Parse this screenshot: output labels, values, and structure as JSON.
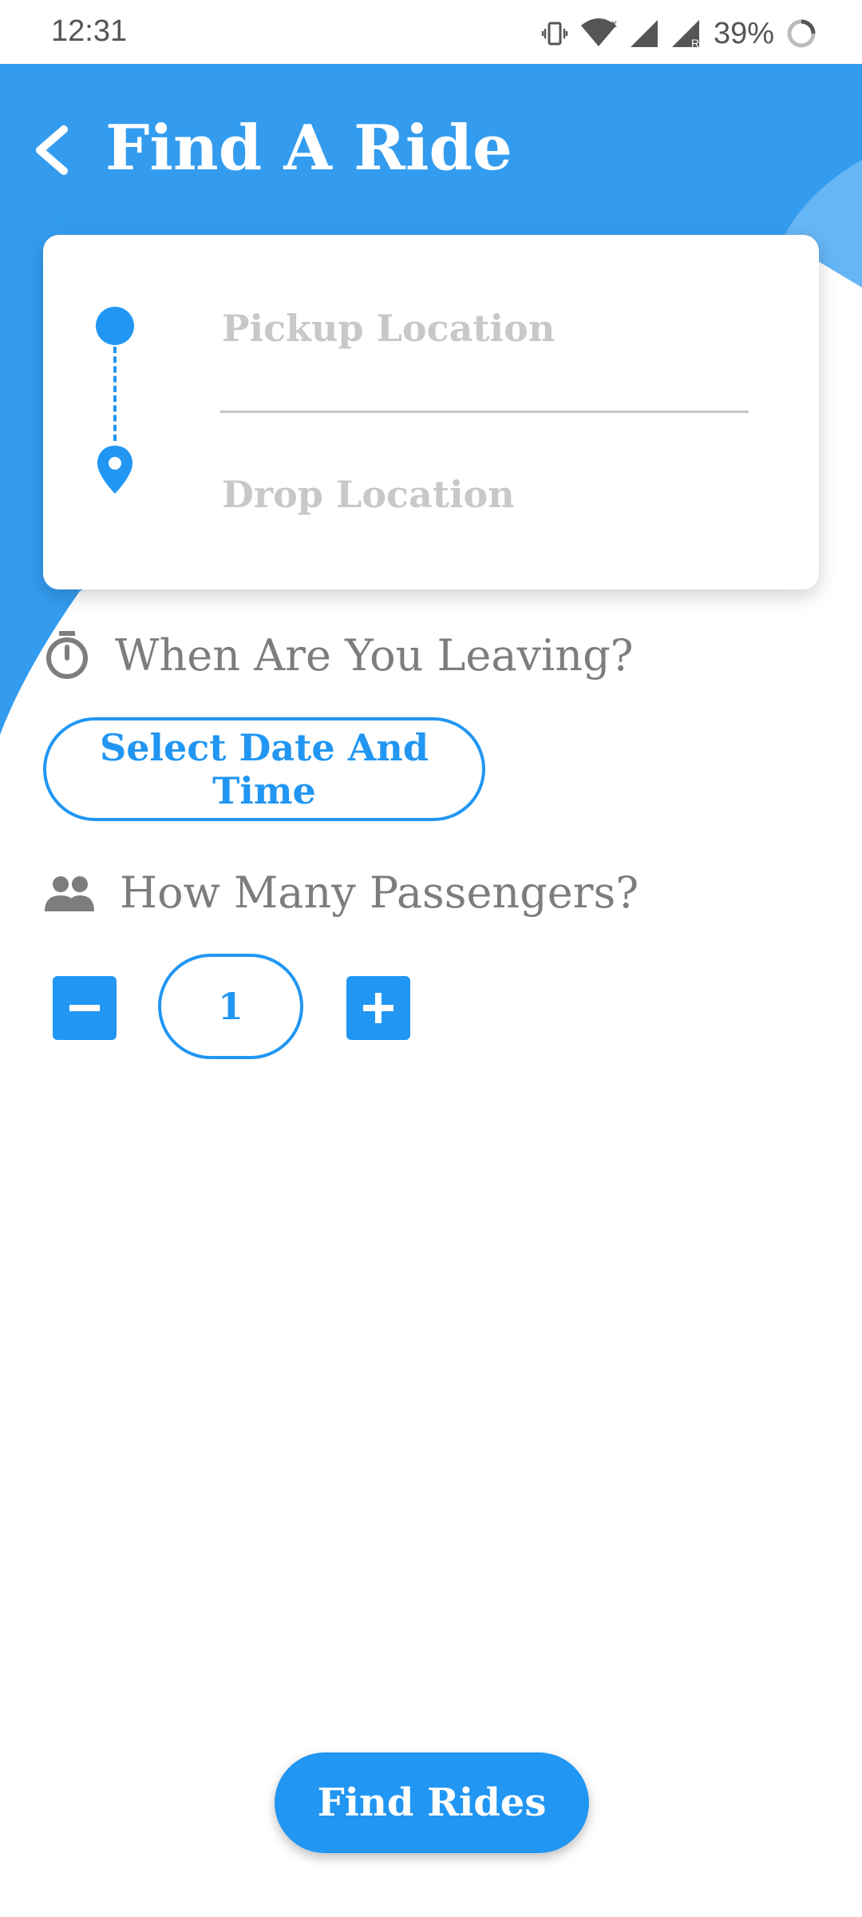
{
  "status_bar": {
    "time": "12:31",
    "battery_percent": "39%",
    "icons": [
      "vibrate-icon",
      "wifi-icon",
      "signal-icon",
      "signal-roaming-icon",
      "battery-ring-icon"
    ]
  },
  "header": {
    "title": "Find A Ride",
    "back_icon": "chevron-left-icon"
  },
  "route_card": {
    "pickup_placeholder": "Pickup Location",
    "drop_placeholder": "Drop Location",
    "pickup_value": "",
    "drop_value": ""
  },
  "when_section": {
    "icon": "stopwatch-icon",
    "label": "When Are You Leaving?",
    "button_label": "Select Date And Time"
  },
  "passengers_section": {
    "icon": "people-icon",
    "label": "How Many Passengers?",
    "count": "1",
    "decrement_icon": "minus-icon",
    "increment_icon": "plus-icon"
  },
  "footer": {
    "find_button_label": "Find Rides"
  },
  "colors": {
    "primary": "#2196f3",
    "header_blue": "#339cef",
    "header_blue_light": "#66b5f5",
    "label_gray": "#7d7d7d",
    "placeholder_gray": "#c8c8c8"
  }
}
